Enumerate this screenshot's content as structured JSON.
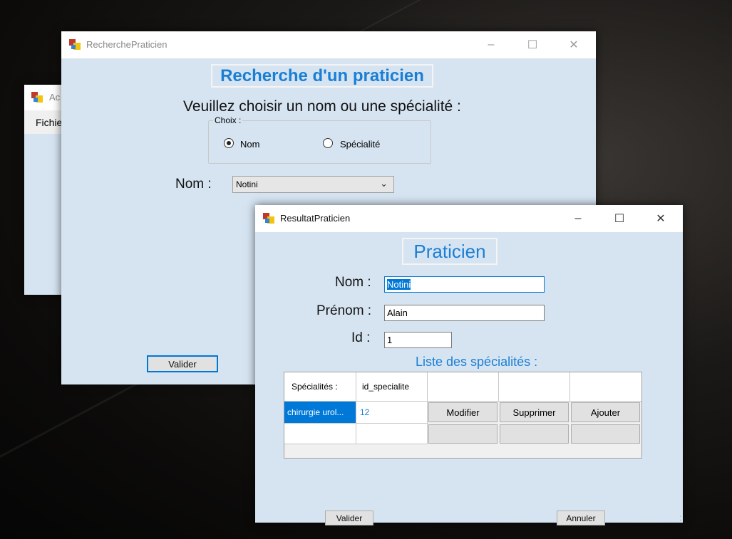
{
  "back_window": {
    "title": "Ac",
    "menu_item": "Fichie"
  },
  "recherche_window": {
    "title": "RecherchePraticien",
    "heading": "Recherche d'un praticien",
    "instruction": "Veuillez choisir un nom ou une spécialité :",
    "groupbox_label": "Choix :",
    "radio_nom_label": "Nom",
    "radio_specialite_label": "Spécialité",
    "selected_radio": "Nom",
    "nom_label": "Nom :",
    "nom_combo_value": "Notini",
    "valider_label": "Valider",
    "minimize_icon": "minimize-icon",
    "maximize_icon": "maximize-icon",
    "close_icon": "close-icon"
  },
  "resultat_window": {
    "title": "ResultatPraticien",
    "heading": "Praticien",
    "nom_label": "Nom :",
    "nom_value": "Notini",
    "prenom_label": "Prénom :",
    "prenom_value": "Alain",
    "id_label": "Id :",
    "id_value": "1",
    "list_heading": "Liste des spécialités :",
    "grid": {
      "columns": [
        "Spécialités :",
        "id_specialite"
      ],
      "rows": [
        {
          "specialite": "chirurgie urol...",
          "id": "12"
        }
      ],
      "row_buttons": [
        "Modifier",
        "Supprimer",
        "Ajouter"
      ]
    },
    "valider_label": "Valider",
    "annuler_label": "Annuler"
  },
  "colors": {
    "accent_blue": "#1a7fd4",
    "client_bg": "#d6e4f2",
    "selection": "#0078d7"
  }
}
